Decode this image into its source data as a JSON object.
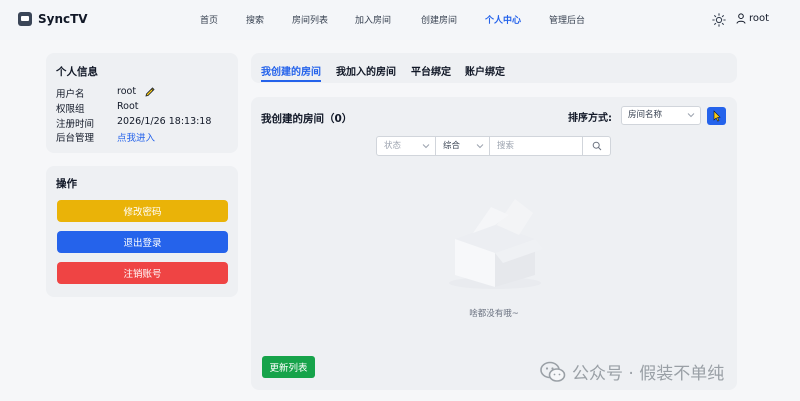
{
  "app": {
    "name": "SyncTV"
  },
  "nav": {
    "items": [
      "首页",
      "搜索",
      "房间列表",
      "加入房间",
      "创建房间",
      "个人中心",
      "管理后台"
    ],
    "active": "个人中心"
  },
  "header": {
    "username": "root"
  },
  "profile": {
    "title": "个人信息",
    "rows": [
      {
        "key": "用户名",
        "value": "root"
      },
      {
        "key": "权限组",
        "value": "Root"
      },
      {
        "key": "注册时间",
        "value": "2026/1/26 18:13:18"
      },
      {
        "key": "后台管理",
        "value": "点我进入"
      }
    ]
  },
  "ops": {
    "title": "操作",
    "change_password": "修改密码",
    "logout": "退出登录",
    "delete_account": "注销账号"
  },
  "tabs": [
    "我创建的房间",
    "我加入的房间",
    "平台绑定",
    "账户绑定"
  ],
  "rooms": {
    "title": "我创建的房间（0）",
    "sort_label": "排序方式:",
    "sort_value": "房间名称",
    "filter_status": "状态",
    "filter_type": "综合",
    "search_placeholder": "搜索",
    "empty_text": "啥都没有哦~",
    "refresh": "更新列表"
  },
  "watermark": "公众号 · 假装不单纯",
  "colors": {
    "accent": "#2563eb",
    "warning": "#eab308",
    "danger": "#ef4444",
    "success": "#16a34a"
  }
}
